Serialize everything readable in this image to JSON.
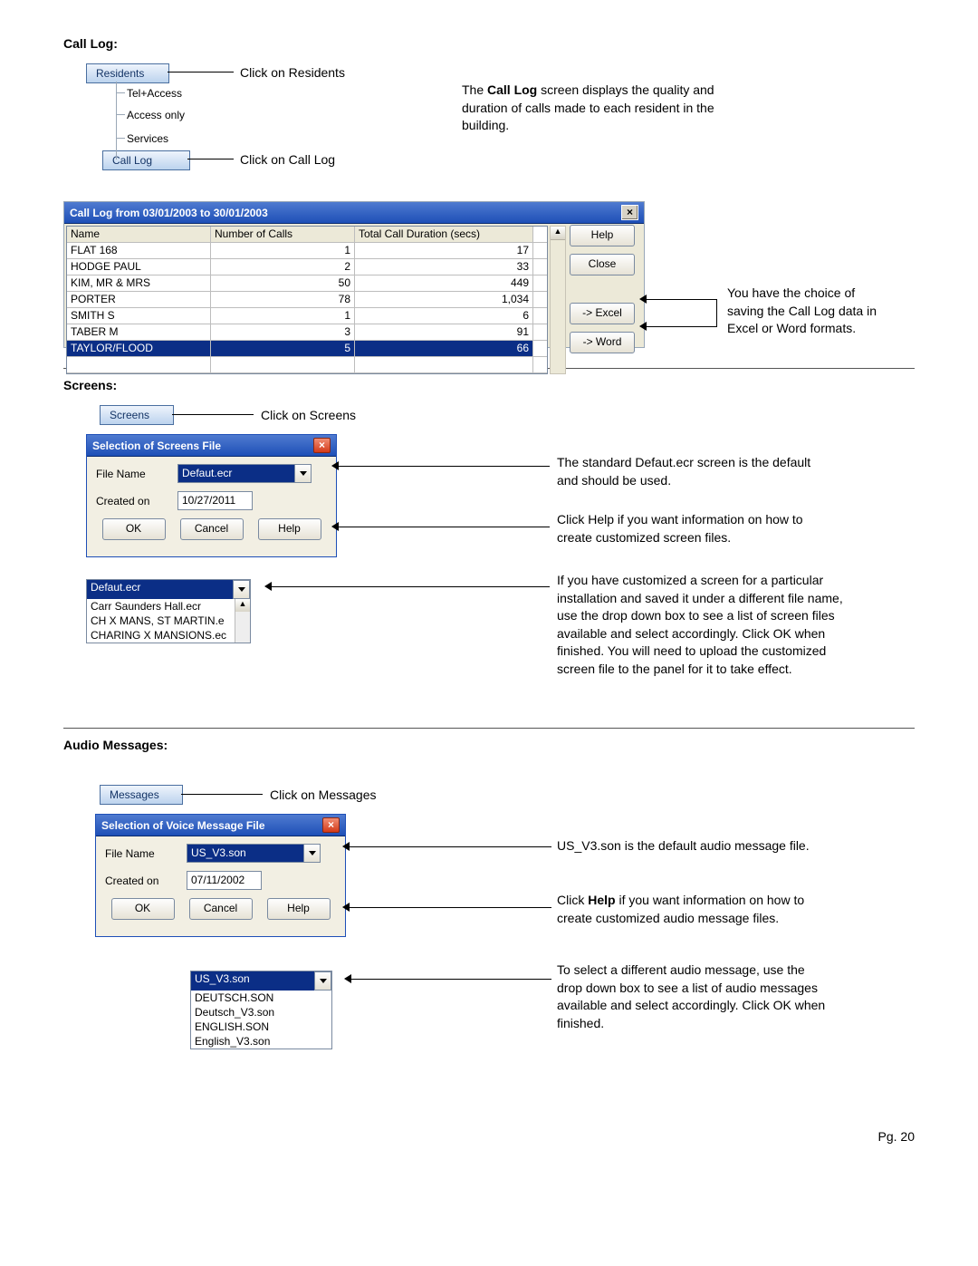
{
  "page_number": "Pg. 20",
  "calllog": {
    "title": "Call Log:",
    "tree": {
      "residents": "Residents",
      "items": [
        "Tel+Access",
        "Access only",
        "Services",
        "Call Log"
      ],
      "callout_residents": "Click on Residents",
      "callout_calllog": "Click on Call Log"
    },
    "intro_1": "The ",
    "intro_bold": "Call Log",
    "intro_2": " screen displays the quality and duration of calls made to each resident in the building.",
    "window_title": "Call Log from 03/01/2003 to 30/01/2003",
    "headers": [
      "Name",
      "Number of Calls",
      "Total Call Duration (secs)"
    ],
    "rows": [
      {
        "name": "FLAT 168",
        "n": "1",
        "d": "17"
      },
      {
        "name": "HODGE PAUL",
        "n": "2",
        "d": "33"
      },
      {
        "name": "KIM, MR & MRS",
        "n": "50",
        "d": "449"
      },
      {
        "name": "PORTER",
        "n": "78",
        "d": "1,034"
      },
      {
        "name": "SMITH S",
        "n": "1",
        "d": "6"
      },
      {
        "name": "TABER M",
        "n": "3",
        "d": "91"
      },
      {
        "name": "TAYLOR/FLOOD",
        "n": "5",
        "d": "66",
        "selected": true
      }
    ],
    "sidebtns": {
      "help": "Help",
      "close": "Close",
      "excel": "-> Excel",
      "word": "-> Word"
    },
    "right_note": "You have the choice of saving the Call Log data in Excel or Word formats."
  },
  "screens": {
    "title": "Screens:",
    "tab": "Screens",
    "tab_callout": "Click on Screens",
    "dlg_title": "Selection of Screens File",
    "file_label": "File Name",
    "file_value": "Defaut.ecr",
    "created_label": "Created on",
    "created_value": "10/27/2011",
    "btns": {
      "ok": "OK",
      "cancel": "Cancel",
      "help": "Help"
    },
    "dropdown": {
      "selected": "Defaut.ecr",
      "items": [
        "Carr Saunders Hall.ecr",
        "CH X MANS, ST MARTIN.e",
        "CHARING X MANSIONS.ec"
      ]
    },
    "para1": "The standard Defaut.ecr screen is the default and should be used.",
    "para2": "Click Help if you want information on how to create customized screen files.",
    "para3": "If you have customized a screen for a particular installation and saved it under a different file name, use the drop down box to see a list of screen files available and select accordingly.  Click OK when finished.  You will need to upload the customized screen file to the panel for it to take effect."
  },
  "audio": {
    "title": "Audio Messages:",
    "tab": "Messages",
    "tab_callout": "Click on Messages",
    "dlg_title": "Selection of Voice Message File",
    "file_label": "File Name",
    "file_value": "US_V3.son",
    "created_label": "Created on",
    "created_value": "07/11/2002",
    "btns": {
      "ok": "OK",
      "cancel": "Cancel",
      "help": "Help"
    },
    "dropdown": {
      "selected": "US_V3.son",
      "items": [
        "DEUTSCH.SON",
        "Deutsch_V3.son",
        "ENGLISH.SON",
        "English_V3.son"
      ]
    },
    "para1": "US_V3.son is the default audio message file.",
    "para2_pre": "Click ",
    "para2_bold": "Help",
    "para2_post": " if you want information on how to create customized audio message files.",
    "para3": "To select a different audio message, use the drop down box to see a list of audio messages available and select accordingly.  Click OK when finished."
  }
}
